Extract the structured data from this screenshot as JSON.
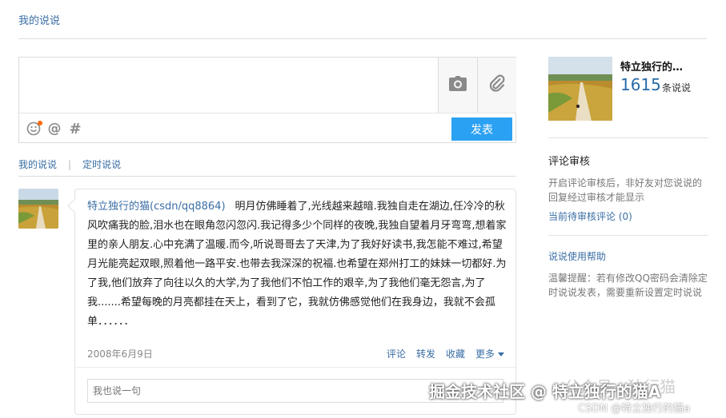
{
  "header": {
    "title": "我的说说"
  },
  "composer": {
    "placeholder": "",
    "post_label": "发表",
    "icons": [
      "camera-icon",
      "attach-icon",
      "emoji-icon",
      "at-icon",
      "hash-icon"
    ],
    "at_symbol": "@",
    "hash_symbol": "#"
  },
  "tabs": [
    {
      "label": "我的说说"
    },
    {
      "label": "定时说说"
    }
  ],
  "tab_separator": "|",
  "feed": {
    "author": "特立独行的猫(csdn/qq8864)",
    "content": "明月仿佛睡着了,光线越来越暗.我独自走在湖边,任冷冷的秋风吹痛我的脸,泪水也在眼角忽闪忽闪.我记得多少个同样的夜晚,我独自望着月牙弯弯,想着家里的亲人朋友.心中充满了温暖.而今,听说哥哥去了天津,为了我好好读书,我怎能不难过,希望月光能亮起双眼,照着他一路平安.也带去我深深的祝福.也希望在郑州打工的妹妹一切都好.为了我,他们放弃了向往以久的大学,为了我他们不怕工作的艰辛,为了我他们毫无怨言,为了我.......希望每晚的月亮都挂在天上，看到了它，我就仿佛感觉他们在我身边，我就不会孤单．．．．．．",
    "date": "2008年6月9日",
    "actions": [
      "评论",
      "转发",
      "收藏",
      "更多"
    ],
    "reply_placeholder": "我也说一句"
  },
  "sidebar": {
    "name": "特立独行的…",
    "count": "1615",
    "count_unit": "条说说",
    "review_heading": "评论审核",
    "review_desc": "开启评论审核后，非好友对您说说的回复经过审核才能显示",
    "review_link": "当前待审核评论 (0)",
    "help_link": "说说使用帮助",
    "tip": "温馨提醒：若有修改QQ密码会清除定时说说发表，需要重新设置定时说说"
  },
  "watermarks": {
    "faded": "公众号 · 独行猫",
    "main": "掘金技术社区 @ 特立独行的猫A",
    "sub": "CSDN @特立独行的猫a"
  },
  "colors": {
    "link": "#3a6ea5",
    "post_button": "#2ba1f3",
    "count": "#2a6aa8",
    "notification_dot": "#ff6a00"
  }
}
